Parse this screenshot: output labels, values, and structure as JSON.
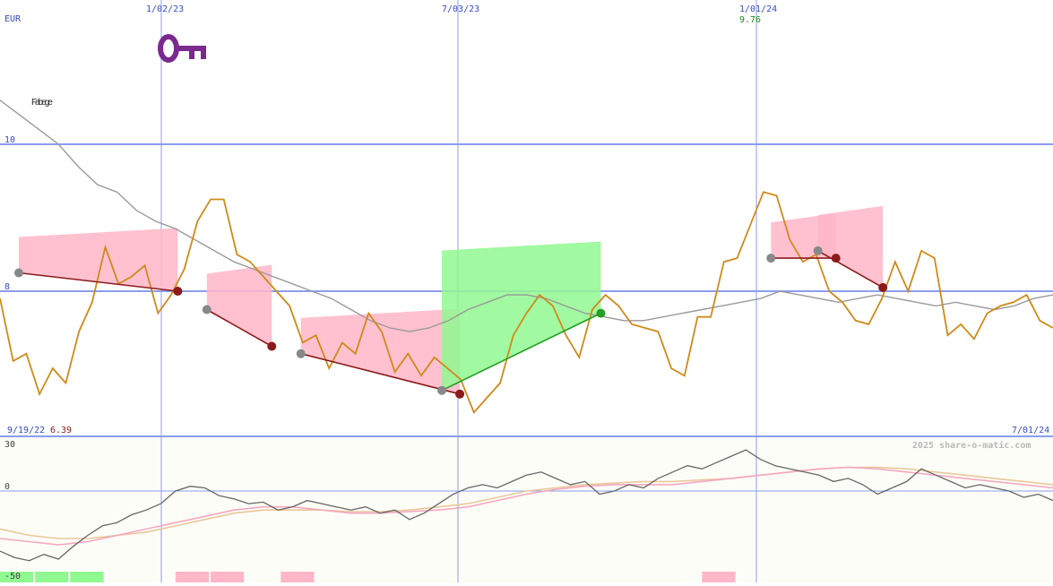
{
  "logo": {
    "brand_text": "Fabege",
    "brand_color": "#222222",
    "key_color": "#7a2a8e",
    "icon": "key-icon"
  },
  "header": {
    "currency": "EUR",
    "date_ticks": [
      "1/02/23",
      "7/03/23",
      "1/01/24"
    ],
    "high_label": "9.76",
    "start_date": "9/19/22",
    "low_label": "6.39",
    "end_date": "7/01/24",
    "watermark": "2025 share-o-matic.com"
  },
  "colors": {
    "price": "#d08a1a",
    "ma_long": "#9a9a9a",
    "up_fill": "#90f890",
    "down_fill": "#ffb6c8",
    "up_line": "#22a022",
    "down_line": "#8b1a1a",
    "grid": "#8c9cf0",
    "osc_main": "#666666",
    "osc_pink": "#f4a8c0",
    "osc_tan": "#e8c89a"
  },
  "chart_data": [
    {
      "type": "line",
      "name": "price chart",
      "ylim": [
        6.0,
        10.5
      ],
      "y_ticks": [
        10,
        8
      ],
      "x_ticks": [
        "1/02/23",
        "7/03/23",
        "1/01/24"
      ],
      "price_series": [
        7.9,
        7.05,
        7.15,
        6.6,
        6.95,
        6.75,
        7.45,
        7.85,
        8.6,
        8.1,
        8.2,
        8.35,
        7.7,
        7.95,
        8.3,
        8.95,
        9.25,
        9.25,
        8.5,
        8.4,
        8.2,
        8.0,
        7.8,
        7.3,
        7.4,
        6.95,
        7.3,
        7.15,
        7.7,
        7.45,
        6.9,
        7.15,
        6.85,
        7.1,
        6.95,
        6.8,
        6.35,
        6.55,
        6.75,
        7.4,
        7.7,
        7.95,
        7.8,
        7.4,
        7.1,
        7.75,
        7.95,
        7.8,
        7.55,
        7.5,
        7.45,
        6.95,
        6.85,
        7.65,
        7.65,
        8.4,
        8.45,
        8.9,
        9.35,
        9.3,
        8.7,
        8.4,
        8.5,
        8.0,
        7.85,
        7.6,
        7.55,
        7.9,
        8.4,
        8.0,
        8.55,
        8.45,
        7.4,
        7.55,
        7.35,
        7.7,
        7.8,
        7.85,
        7.95,
        7.6,
        7.5
      ],
      "ma_long_series": [
        10.6,
        10.4,
        10.2,
        10.0,
        9.7,
        9.45,
        9.35,
        9.1,
        8.95,
        8.85,
        8.7,
        8.55,
        8.4,
        8.3,
        8.2,
        8.1,
        8.0,
        7.9,
        7.75,
        7.6,
        7.5,
        7.45,
        7.5,
        7.6,
        7.75,
        7.85,
        7.95,
        7.95,
        7.9,
        7.8,
        7.7,
        7.65,
        7.6,
        7.6,
        7.65,
        7.7,
        7.75,
        7.8,
        7.85,
        7.9,
        8.0,
        7.95,
        7.9,
        7.85,
        7.9,
        7.95,
        7.9,
        7.85,
        7.8,
        7.85,
        7.8,
        7.75,
        7.8,
        7.9,
        7.95
      ],
      "signals": [
        {
          "from": "Oct 2022",
          "to": "Jan 2023",
          "kind": "sell",
          "entry": 8.25,
          "exit": 8.0
        },
        {
          "from": "Feb 2023",
          "to": "Mar 2023",
          "kind": "sell",
          "entry": 7.75,
          "exit": 7.25
        },
        {
          "from": "Apr 2023",
          "to": "Jul 2023",
          "kind": "sell",
          "entry": 7.15,
          "exit": 6.6
        },
        {
          "from": "Jul 2023",
          "to": "Oct 2023",
          "kind": "buy",
          "entry": 6.65,
          "exit": 7.7
        },
        {
          "from": "Feb 2024",
          "to": "Mar 2024",
          "kind": "sell",
          "entry": 8.45,
          "exit": 8.45
        },
        {
          "from": "Mar 2024",
          "to": "Apr 2024",
          "kind": "sell",
          "entry": 8.55,
          "exit": 8.05
        }
      ]
    },
    {
      "type": "line",
      "name": "oscillator",
      "ylim": [
        -50,
        30
      ],
      "y_ticks": [
        30,
        0,
        -50
      ],
      "osc_main": [
        -38,
        -42,
        -44,
        -40,
        -43,
        -35,
        -28,
        -22,
        -20,
        -15,
        -12,
        -8,
        0,
        3,
        2,
        -3,
        -5,
        -8,
        -7,
        -12,
        -10,
        -6,
        -8,
        -10,
        -12,
        -10,
        -14,
        -12,
        -18,
        -14,
        -8,
        -2,
        2,
        4,
        2,
        6,
        10,
        12,
        8,
        4,
        6,
        -2,
        0,
        4,
        2,
        8,
        12,
        16,
        14,
        18,
        22,
        26,
        20,
        16,
        14,
        12,
        10,
        6,
        8,
        4,
        -2,
        2,
        6,
        14,
        10,
        6,
        2,
        4,
        2,
        0,
        -4,
        -2,
        -6
      ],
      "osc_pink": [
        -30,
        -32,
        -34,
        -32,
        -28,
        -24,
        -20,
        -16,
        -12,
        -10,
        -10,
        -12,
        -14,
        -14,
        -13,
        -12,
        -10,
        -6,
        -2,
        1,
        3,
        4,
        4,
        4,
        6,
        8,
        10,
        12,
        14,
        15,
        14,
        12,
        10,
        8,
        6,
        4,
        2
      ],
      "osc_tan": [
        -24,
        -28,
        -30,
        -30,
        -28,
        -26,
        -22,
        -18,
        -14,
        -12,
        -12,
        -12,
        -13,
        -13,
        -12,
        -10,
        -8,
        -4,
        0,
        2,
        4,
        5,
        6,
        6,
        7,
        8,
        10,
        12,
        14,
        15,
        15,
        14,
        12,
        10,
        8,
        6,
        4
      ],
      "histogram": [
        1,
        1,
        1,
        0,
        0,
        -1,
        -1,
        0,
        -1,
        0,
        0,
        0,
        0,
        0,
        0,
        0,
        0,
        0,
        0,
        0,
        -1,
        0,
        0,
        0,
        0,
        0,
        0,
        0,
        0,
        0
      ]
    }
  ]
}
